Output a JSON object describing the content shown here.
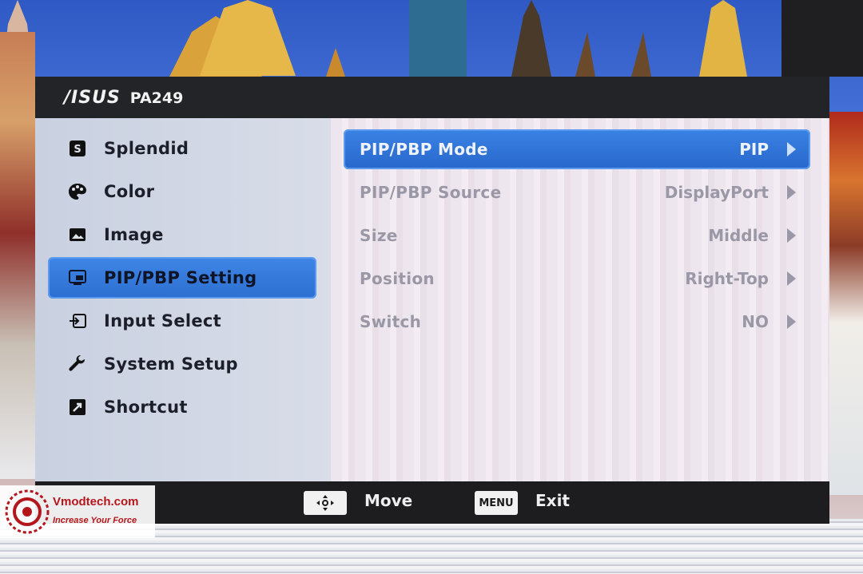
{
  "header": {
    "brand": "/ISUS",
    "model": "PA249"
  },
  "sidebar": {
    "items": [
      {
        "label": "Splendid",
        "icon": "splendid-icon"
      },
      {
        "label": "Color",
        "icon": "palette-icon"
      },
      {
        "label": "Image",
        "icon": "image-icon"
      },
      {
        "label": "PIP/PBP Setting",
        "icon": "pip-icon",
        "active": true
      },
      {
        "label": "Input Select",
        "icon": "input-icon"
      },
      {
        "label": "System Setup",
        "icon": "wrench-icon"
      },
      {
        "label": "Shortcut",
        "icon": "shortcut-icon"
      }
    ]
  },
  "settings": {
    "rows": [
      {
        "label": "PIP/PBP Mode",
        "value": "PIP",
        "active": true
      },
      {
        "label": "PIP/PBP Source",
        "value": "DisplayPort"
      },
      {
        "label": "Size",
        "value": "Middle"
      },
      {
        "label": "Position",
        "value": "Right-Top"
      },
      {
        "label": "Switch",
        "value": "NO"
      }
    ]
  },
  "footer": {
    "move_label": "Move",
    "menu_key": "MENU",
    "exit_label": "Exit"
  },
  "watermark": {
    "name": "Vmodtech.com",
    "tagline": "Increase Your Force"
  },
  "colors": {
    "accent": "#2c6fd0",
    "titlebar": "#232427",
    "footer": "#1d1d20"
  }
}
